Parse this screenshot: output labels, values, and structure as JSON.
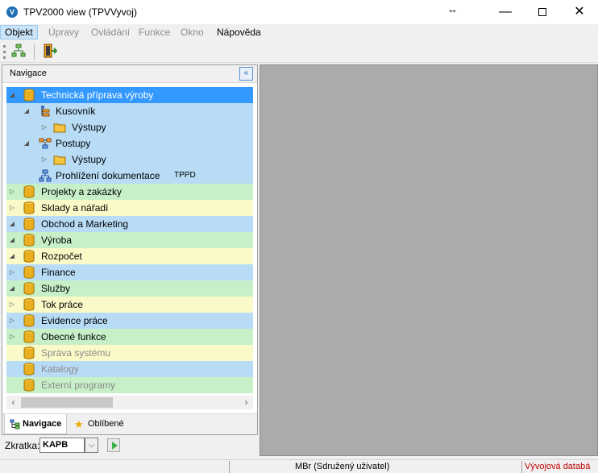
{
  "window": {
    "title": "TPV2000 view (TPVVyvoj)",
    "app_icon_letter": "V"
  },
  "menu": {
    "items": [
      "Objekt",
      "Úpravy",
      "Ovládání",
      "Funkce",
      "Okno",
      "Nápověda"
    ]
  },
  "navigation": {
    "title": "Navigace",
    "collapse_glyph": "«",
    "tree": [
      {
        "label": "Technická příprava výroby",
        "state": "expanded",
        "selected": true
      },
      {
        "label": "Kusovník",
        "state": "expanded"
      },
      {
        "label": "Výstupy",
        "state": "collapsed"
      },
      {
        "label": "Postupy",
        "state": "expanded"
      },
      {
        "label": "Výstupy",
        "state": "collapsed"
      },
      {
        "label": "Prohlížení dokumentace",
        "badge": "TPPD"
      },
      {
        "label": "Projekty a zakázky",
        "state": "collapsed"
      },
      {
        "label": "Sklady a nářadí",
        "state": "collapsed"
      },
      {
        "label": "Obchod a Marketing",
        "state": "expanded"
      },
      {
        "label": "Výroba",
        "state": "expanded"
      },
      {
        "label": "Rozpočet",
        "state": "expanded"
      },
      {
        "label": "Finance",
        "state": "collapsed"
      },
      {
        "label": "Služby",
        "state": "expanded"
      },
      {
        "label": "Tok práce",
        "state": "collapsed"
      },
      {
        "label": "Evidence práce",
        "state": "collapsed"
      },
      {
        "label": "Obecné funkce",
        "state": "collapsed"
      },
      {
        "label": "Správa systému",
        "disabled": true
      },
      {
        "label": "Katalogy",
        "disabled": true
      },
      {
        "label": "Externí programy",
        "disabled": true
      }
    ],
    "tabs": [
      "Navigace",
      "Oblíbené"
    ]
  },
  "shortcut": {
    "label": "Zkratka:",
    "value": "KAPB"
  },
  "status": {
    "user": "MBr (Sdružený uživatel)",
    "database": "Vývojová databá"
  },
  "colors": {
    "selected": "#3399ff",
    "row_blue": "#b8dcf5",
    "row_green": "#c8f0c8",
    "row_yellow": "#fafac8",
    "workspace": "#ababab",
    "status_db": "#c00000"
  }
}
